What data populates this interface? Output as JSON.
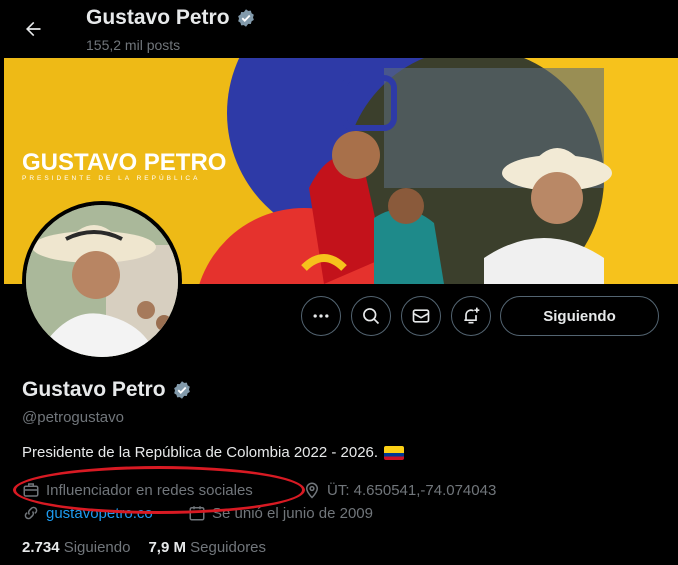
{
  "header": {
    "title": "Gustavo Petro",
    "posts_count": "155,2 mil posts"
  },
  "banner": {
    "brand_title": "GUSTAVO PETRO",
    "brand_subtitle": "PRESIDENTE DE LA REPÚBLICA"
  },
  "actions": {
    "follow_label": "Siguiendo"
  },
  "profile": {
    "name": "Gustavo Petro",
    "handle": "@petrogustavo",
    "bio": "Presidente de la República de Colombia 2022 - 2026.",
    "category": "Influenciador en redes sociales",
    "location": "ÜT: 4.650541,-74.074043",
    "website": "gustavopetro.co",
    "joined": "Se unió el junio de 2009"
  },
  "stats": {
    "following_count": "2.734",
    "following_label": "Siguiendo",
    "followers_count": "7,9 M",
    "followers_label": "Seguidores"
  },
  "colors": {
    "verified": "#829aab",
    "link": "#1d9bf0",
    "highlight": "#d81a23",
    "banner_yellow": "#f6c21c",
    "banner_blue": "#2e3aa7",
    "banner_red": "#e5322d"
  }
}
